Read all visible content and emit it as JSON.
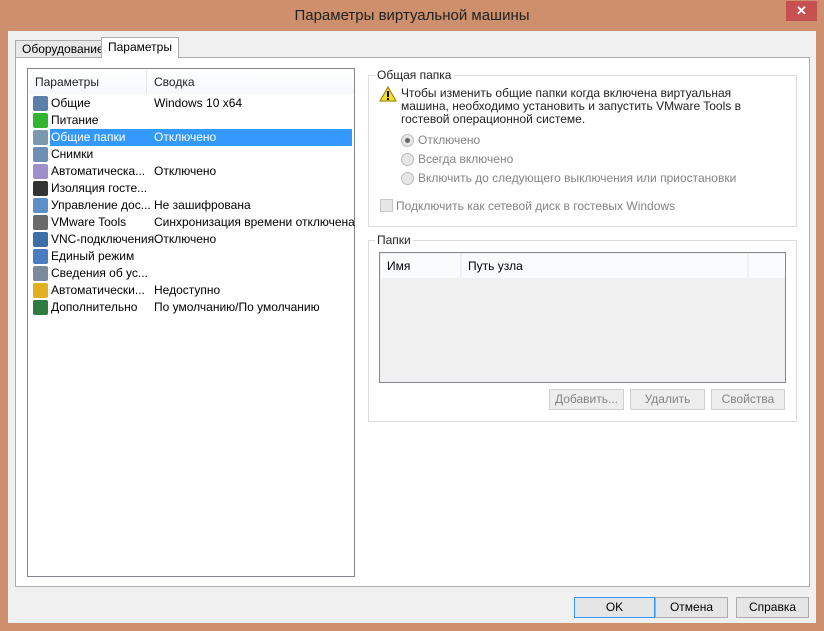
{
  "window": {
    "title": "Параметры виртуальной машины",
    "close": "✕"
  },
  "tabs": [
    {
      "label": "Оборудование"
    },
    {
      "label": "Параметры"
    }
  ],
  "list": {
    "headers": [
      "Параметры",
      "Сводка"
    ],
    "items": [
      {
        "name": "Общие",
        "value": "Windows 10 x64",
        "icon": "monitor-icon",
        "color": "#5a7fa8"
      },
      {
        "name": "Питание",
        "value": "",
        "icon": "play-icon",
        "color": "#2fb52f"
      },
      {
        "name": "Общие папки",
        "value": "Отключено",
        "icon": "folder-icon",
        "color": "#7b98ad"
      },
      {
        "name": "Снимки",
        "value": "",
        "icon": "snapshot-clock-icon",
        "color": "#6d8fb5"
      },
      {
        "name": "Автоматическа...",
        "value": "Отключено",
        "icon": "autoprotect-icon",
        "color": "#9d8fc9"
      },
      {
        "name": "Изоляция госте...",
        "value": "",
        "icon": "lock-icon",
        "color": "#333333"
      },
      {
        "name": "Управление дос...",
        "value": "Не зашифрована",
        "icon": "access-control-icon",
        "color": "#5d8fc9"
      },
      {
        "name": "VMware Tools",
        "value": "Синхронизация времени отключена",
        "icon": "vmware-icon",
        "color": "#6a6a6a"
      },
      {
        "name": "VNC-подключения",
        "value": "Отключено",
        "icon": "vnc-icon",
        "color": "#3d6ea8"
      },
      {
        "name": "Единый режим",
        "value": "",
        "icon": "unity-icon",
        "color": "#4a7cc0"
      },
      {
        "name": "Сведения об ус...",
        "value": "",
        "icon": "appliance-info-icon",
        "color": "#7a8a9a"
      },
      {
        "name": "Автоматически...",
        "value": "Недоступно",
        "icon": "autologon-icon",
        "color": "#e0b020"
      },
      {
        "name": "Дополнительно",
        "value": "По умолчанию/По умолчанию",
        "icon": "advanced-icon",
        "color": "#2f7a3f"
      }
    ],
    "selected": 2
  },
  "shared": {
    "legend": "Общая папка",
    "warning": [
      "Чтобы изменить общие папки когда включена виртуальная",
      "машина, необходимо установить и запустить VMware Tools в",
      "гостевой операционной системе."
    ],
    "options": [
      "Отключено",
      "Всегда включено",
      "Включить до следующего выключения или приостановки"
    ],
    "selected": 0,
    "map_drive": "Подключить как сетевой диск в гостевых Windows"
  },
  "folders": {
    "legend": "Папки",
    "headers": [
      "Имя",
      "Путь узла"
    ],
    "add": "Добавить...",
    "remove": "Удалить",
    "props": "Свойства"
  },
  "footer": {
    "ok": "OK",
    "cancel": "Отмена",
    "help": "Справка"
  }
}
